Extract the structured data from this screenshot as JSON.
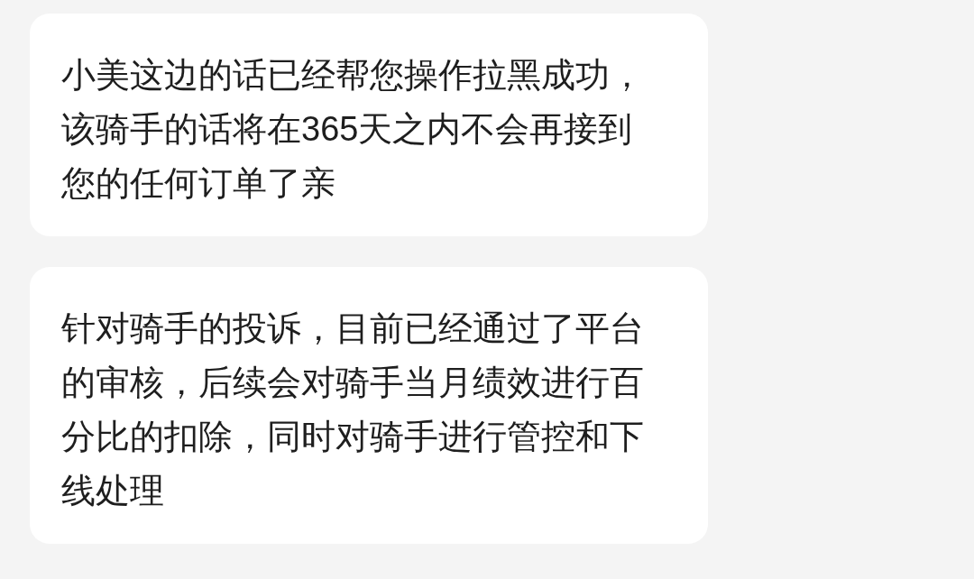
{
  "messages": [
    {
      "text": "小美这边的话已经帮您操作拉黑成功，该骑手的话将在365天之内不会再接到您的任何订单了亲"
    },
    {
      "text": "针对骑手的投诉，目前已经通过了平台的审核，后续会对骑手当月绩效进行百分比的扣除，同时对骑手进行管控和下线处理"
    }
  ]
}
